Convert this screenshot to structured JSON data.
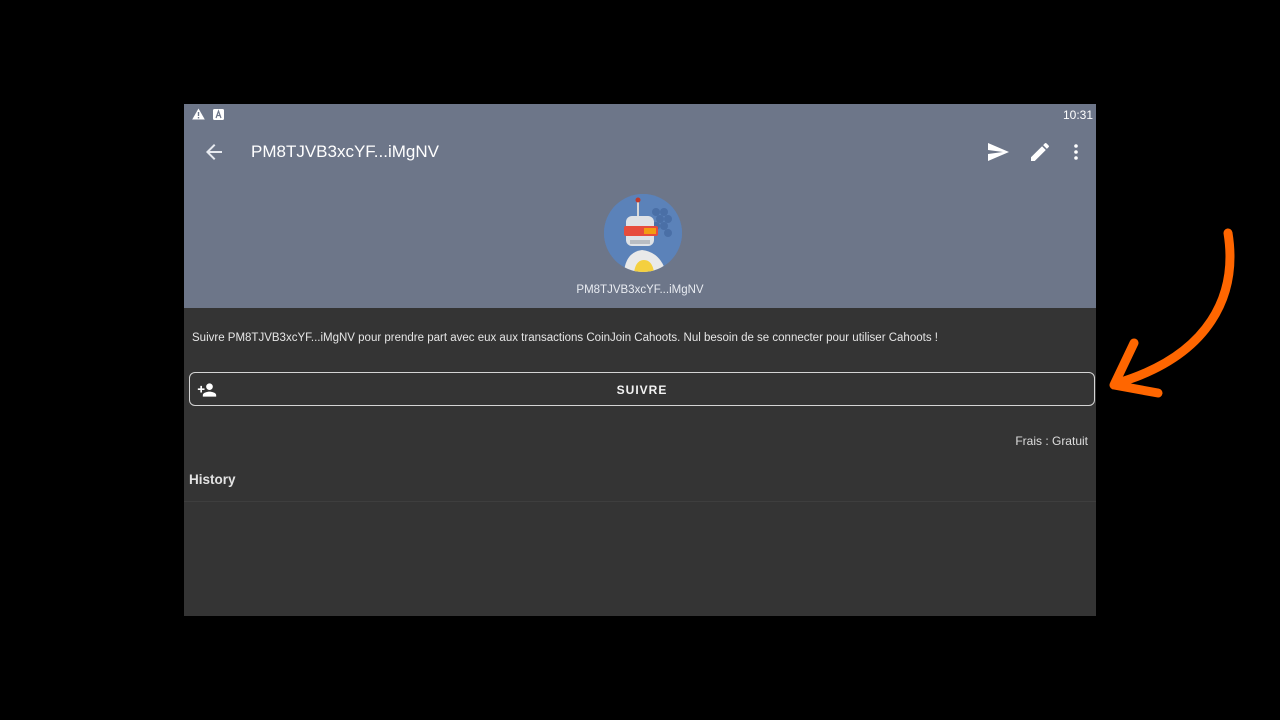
{
  "status_bar": {
    "time": "10:31",
    "icons": [
      "warning-icon",
      "notification-a-icon"
    ]
  },
  "app_bar": {
    "title": "PM8TJVB3xcYF...iMgNV",
    "actions": [
      "send-icon",
      "edit-icon",
      "more-vert-icon"
    ]
  },
  "profile": {
    "nym": "PM8TJVB3xcYF...iMgNV"
  },
  "description": "Suivre PM8TJVB3xcYF...iMgNV pour prendre part avec eux aux transactions CoinJoin Cahoots. Nul besoin de se connecter pour utiliser Cahoots !",
  "follow_button": {
    "label": "SUIVRE",
    "icon": "person-add-icon"
  },
  "fees": "Frais : Gratuit",
  "history": {
    "title": "History"
  },
  "colors": {
    "header": "#6d7689",
    "background": "#343434",
    "annotation_arrow": "#ff6600"
  }
}
